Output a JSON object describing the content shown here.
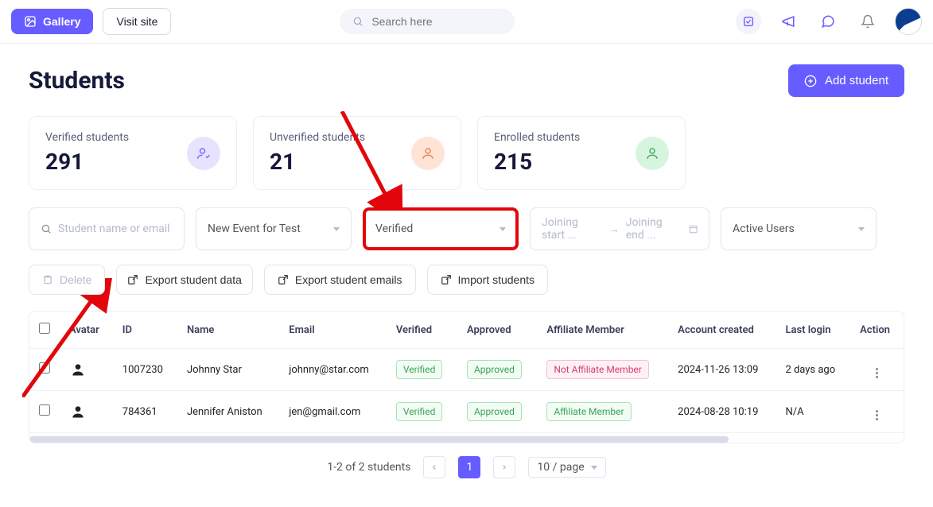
{
  "header": {
    "gallery": "Gallery",
    "visit_site": "Visit site",
    "search_placeholder": "Search here"
  },
  "page": {
    "title": "Students",
    "add_button": "Add student"
  },
  "stats": [
    {
      "label": "Verified students",
      "value": "291",
      "icon_color": "#dedbff",
      "icon_stroke": "#7e6cff"
    },
    {
      "label": "Unverified students",
      "value": "21",
      "icon_color": "#ffe4d6",
      "icon_stroke": "#e5895a"
    },
    {
      "label": "Enrolled students",
      "value": "215",
      "icon_color": "#d6f5df",
      "icon_stroke": "#4caa6d"
    }
  ],
  "filters": {
    "search_placeholder": "Student name or email",
    "event_select": "New Event for Test",
    "verified_select": "Verified",
    "join_start": "Joining start ...",
    "join_end": "Joining end ...",
    "user_status": "Active Users"
  },
  "actions": {
    "delete": "Delete",
    "export_data": "Export student data",
    "export_emails": "Export student emails",
    "import": "Import students"
  },
  "table": {
    "columns": {
      "avatar": "Avatar",
      "id": "ID",
      "name": "Name",
      "email": "Email",
      "verified": "Verified",
      "approved": "Approved",
      "affiliate": "Affiliate Member",
      "created": "Account created",
      "last_login": "Last login",
      "action": "Action"
    },
    "rows": [
      {
        "id": "1007230",
        "name": "Johnny Star",
        "email": "johnny@star.com",
        "verified": "Verified",
        "approved": "Approved",
        "affiliate": "Not Affiliate Member",
        "affiliate_style": "b-pink",
        "created": "2024-11-26 13:09",
        "last_login": "2 days ago"
      },
      {
        "id": "784361",
        "name": "Jennifer Aniston",
        "email": "jen@gmail.com",
        "verified": "Verified",
        "approved": "Approved",
        "affiliate": "Affiliate Member",
        "affiliate_style": "b-green",
        "created": "2024-08-28 10:19",
        "last_login": "N/A"
      }
    ]
  },
  "pager": {
    "summary": "1-2 of 2 students",
    "current": "1",
    "per_page": "10 / page"
  }
}
